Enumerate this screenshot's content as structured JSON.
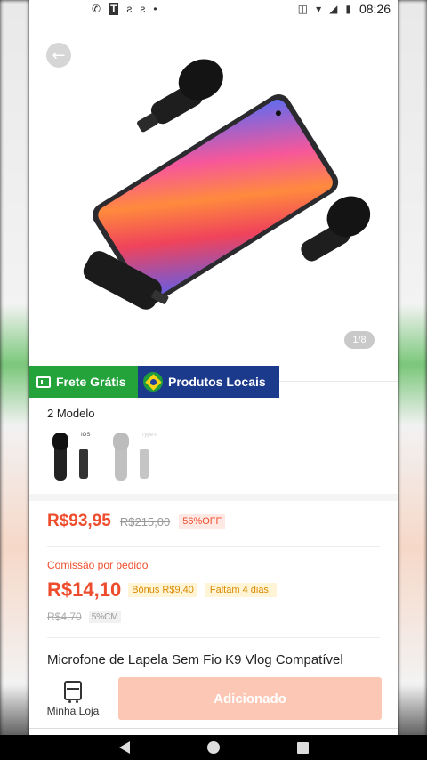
{
  "status_bar": {
    "time": "08:26",
    "left_icons": [
      "whatsapp-icon",
      "t-app-icon",
      "notification-icon",
      "notification-icon",
      "dot-icon"
    ],
    "right_icons": [
      "vibrate-icon",
      "wifi-icon",
      "signal-icon",
      "battery-icon"
    ]
  },
  "gallery": {
    "counter": "1/8"
  },
  "badges": {
    "frete": "Frete Grátis",
    "local": "Produtos Locais"
  },
  "models": {
    "title": "2 Modelo",
    "thumb_tags": [
      "IOS",
      "Type-c"
    ]
  },
  "price": {
    "current": "R$93,95",
    "original": "R$215,00",
    "discount": "56%OFF"
  },
  "commission": {
    "label": "Comissão por pedido",
    "value": "R$14,10",
    "bonus": "Bônus R$9,40",
    "days": "Faltam 4 dias.",
    "old": "R$4,70",
    "cm": "5%CM"
  },
  "product": {
    "title": "Microfone de Lapela Sem Fio K9 Vlog Compatível"
  },
  "action_bar": {
    "shop_label": "Minha Loja",
    "add_label": "Adicionado"
  },
  "colors": {
    "accent": "#ee4d2d",
    "frete_green": "#24a33b",
    "local_blue": "#1c3a8c",
    "add_button_disabled": "#fcc7b4"
  }
}
